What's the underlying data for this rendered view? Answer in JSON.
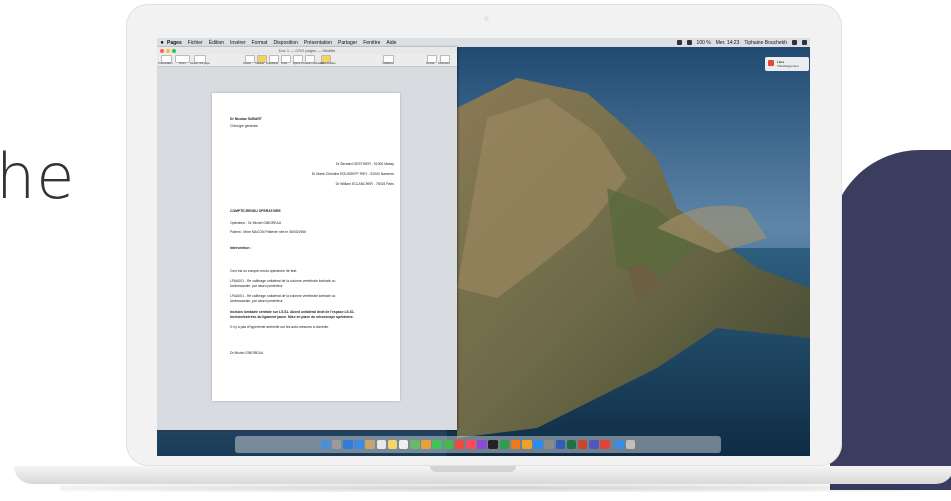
{
  "headline_fragment": "he",
  "menubar": {
    "app_name": "Pages",
    "items": [
      "Fichier",
      "Édition",
      "Insérer",
      "Format",
      "Disposition",
      "Présentation",
      "Partager",
      "Fenêtre",
      "Aide"
    ],
    "status_right": [
      "100 %",
      "Mer. 14:23",
      "Tiphaine Bouchekh"
    ]
  },
  "window": {
    "title": "Doc 1 — CRO pages — Modifié",
    "toolbar_labels": [
      "Présentation",
      "Zoom",
      "Ajouter une page",
      "Insérer",
      "Tableau",
      "Graphique",
      "Texte",
      "Figure",
      "Contenu multimédia",
      "Commentaire",
      "Collaborer",
      "Format",
      "Document"
    ]
  },
  "document": {
    "author": "Dr Nicolas SUBART",
    "dept": "Chirurgie générale",
    "recipients": [
      "Dr Bernard GESTHIER - 91300 Massy",
      "Dr Marie-Christine ROUSSEFF RIEY - 92000 Nanterre",
      "Dr William ECLANCHER - 75015 Paris"
    ],
    "report_title": "COMPTE-RENDU OPERATOIRE",
    "operator": "Opérateur : Dr Michel GIBOREAU",
    "patient": "Patient : Mme MACON  Patiente née le 05/03/1986",
    "intervention": "Intervention :",
    "body": [
      "Ceci est un compte-rendu opératoire de test.",
      "LFAA001 - Re calibrage unilatéral de la colonne vertébrale lombale ou",
      "lombosacrale, par abord postérieur",
      "LFAA001 - Re calibrage unilatéral de la colonne vertébrale lombale ou",
      "lombosacrale, par abord postérieur"
    ],
    "bold_body": [
      "Incision lombaire centrale sur L5-S1. Abord unilatéral droit de l'espace L5-S1.",
      "Incision/exérèse du ligament jaune. Mise en place du microscope opératoire."
    ],
    "closing": "Il n'y a pas d'hyperémie artérielle sur les auto-mesures à domicile.",
    "signature": "Dr Michel GIBOREAU"
  },
  "notification": {
    "app": "Libre",
    "text": "Téléchargement"
  },
  "colors": {
    "navy": "#3a3d5e",
    "accent_red": "#e04a2f"
  },
  "dock_icons": [
    "finder-icon",
    "launchpad-icon",
    "safari-icon",
    "mail-icon",
    "contacts-icon",
    "calendar-icon",
    "notes-icon",
    "reminders-icon",
    "maps-icon",
    "photos-icon",
    "messages-icon",
    "facetime-icon",
    "news-icon",
    "music-icon",
    "podcasts-icon",
    "tv-icon",
    "numbers-icon",
    "keynote-icon",
    "pages-icon",
    "appstore-icon",
    "settings-icon",
    "word-icon",
    "excel-icon",
    "powerpoint-icon",
    "teams-icon",
    "chrome-icon",
    "folder-icon",
    "trash-icon"
  ]
}
